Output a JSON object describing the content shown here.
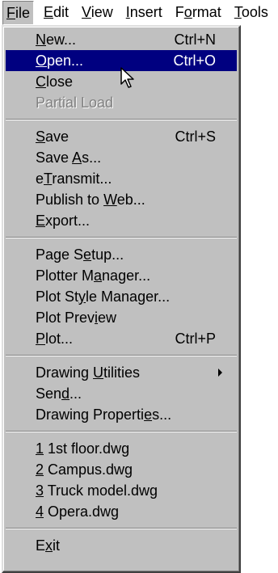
{
  "menubar": {
    "items": [
      {
        "label": "File",
        "mnemonic": 0,
        "active": true
      },
      {
        "label": "Edit",
        "mnemonic": 0
      },
      {
        "label": "View",
        "mnemonic": 0
      },
      {
        "label": "Insert",
        "mnemonic": 0
      },
      {
        "label": "Format",
        "mnemonic": 1
      },
      {
        "label": "Tools",
        "mnemonic": 0
      }
    ]
  },
  "file_menu": {
    "groups": [
      [
        {
          "id": "new",
          "label": "New...",
          "mnemonic": 0,
          "shortcut": "Ctrl+N"
        },
        {
          "id": "open",
          "label": "Open...",
          "mnemonic": 0,
          "shortcut": "Ctrl+O",
          "highlighted": true
        },
        {
          "id": "close",
          "label": "Close",
          "mnemonic": 0
        },
        {
          "id": "partial-load",
          "label": "Partial Load",
          "disabled": true
        }
      ],
      [
        {
          "id": "save",
          "label": "Save",
          "mnemonic": 0,
          "shortcut": "Ctrl+S"
        },
        {
          "id": "save-as",
          "label": "Save As...",
          "mnemonic": 5
        },
        {
          "id": "etransmit",
          "label": "eTransmit...",
          "mnemonic": 1
        },
        {
          "id": "publish-to-web",
          "label": "Publish to Web...",
          "mnemonic": 11
        },
        {
          "id": "export",
          "label": "Export...",
          "mnemonic": 0
        }
      ],
      [
        {
          "id": "page-setup",
          "label": "Page Setup...",
          "mnemonic": 6
        },
        {
          "id": "plotter-manager",
          "label": "Plotter Manager...",
          "mnemonic": 9
        },
        {
          "id": "plot-style-manager",
          "label": "Plot Style Manager...",
          "mnemonic": 7
        },
        {
          "id": "plot-preview",
          "label": "Plot Preview",
          "mnemonic": 9
        },
        {
          "id": "plot",
          "label": "Plot...",
          "mnemonic": 0,
          "shortcut": "Ctrl+P"
        }
      ],
      [
        {
          "id": "drawing-utilities",
          "label": "Drawing Utilities",
          "mnemonic": 8,
          "submenu": true
        },
        {
          "id": "send",
          "label": "Send...",
          "mnemonic": 3
        },
        {
          "id": "drawing-properties",
          "label": "Drawing Properties...",
          "mnemonic": 16
        }
      ],
      [
        {
          "id": "recent-1",
          "label": "1 1st floor.dwg",
          "mnemonic": 0
        },
        {
          "id": "recent-2",
          "label": "2 Campus.dwg",
          "mnemonic": 0
        },
        {
          "id": "recent-3",
          "label": "3 Truck model.dwg",
          "mnemonic": 0
        },
        {
          "id": "recent-4",
          "label": "4 Opera.dwg",
          "mnemonic": 0
        }
      ],
      [
        {
          "id": "exit",
          "label": "Exit",
          "mnemonic": 1
        }
      ]
    ]
  }
}
